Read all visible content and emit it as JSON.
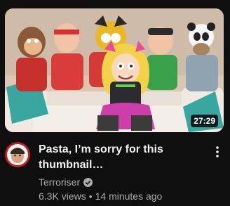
{
  "video": {
    "duration": "27:29",
    "title_line1": "Pasta, I’m sorry for this",
    "title_line2": "thumbnail…",
    "channel": "Terroriser",
    "views": "6.3K views",
    "separator": "•",
    "age": "14 minutes ago"
  },
  "icons": {
    "verified": "verified-check-icon",
    "menu": "more-vertical-icon",
    "avatar": "channel-avatar"
  },
  "colors": {
    "background": "#0f0f0f",
    "title": "#f1f1f1",
    "secondary_text": "#aaaaaa",
    "duration_badge": "#000000"
  }
}
